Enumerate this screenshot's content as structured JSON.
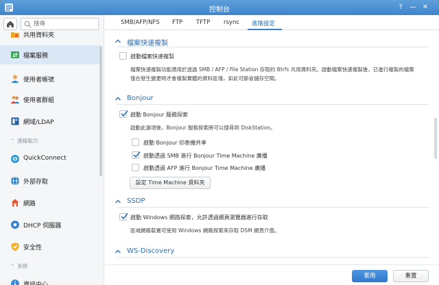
{
  "window": {
    "title": "控制台"
  },
  "sidebar": {
    "search_placeholder": "搜尋",
    "items": [
      {
        "label": "共用資料夾",
        "icon": "folder-share-icon"
      },
      {
        "label": "檔案服務",
        "icon": "file-services-icon",
        "active": true
      },
      {
        "label": "使用者帳號",
        "icon": "user-icon"
      },
      {
        "label": "使用者群組",
        "icon": "user-group-icon"
      },
      {
        "label": "網域/LDAP",
        "icon": "domain-ldap-icon"
      },
      {
        "label": "QuickConnect",
        "icon": "quickconnect-icon"
      },
      {
        "label": "外部存取",
        "icon": "external-access-icon"
      },
      {
        "label": "網路",
        "icon": "network-icon"
      },
      {
        "label": "DHCP 伺服器",
        "icon": "dhcp-server-icon"
      },
      {
        "label": "安全性",
        "icon": "security-icon"
      },
      {
        "label": "資訊中心",
        "icon": "info-center-icon"
      }
    ],
    "sections": [
      "連線能力",
      "系統"
    ]
  },
  "tabs": [
    "SMB/AFP/NFS",
    "FTP",
    "TFTP",
    "rsync",
    "進階設定"
  ],
  "active_tab": "進階設定",
  "file_copy": {
    "heading": "檔案快速複製",
    "checkbox_label": "啟動檔案快速複製",
    "checked": false,
    "description_line1": "檔案快速複製功能適用於透過 SMB / AFP / File Station 存取的 Btrfs 共用資料夾。啟動檔案快速複製後，已進行複製的檔案",
    "description_line2": "僅在發生變更時才會複製實體的資料區塊，如此可節省儲存空間。"
  },
  "bonjour": {
    "heading": "Bonjour",
    "main_label": "啟動 Bonjour 服務探索",
    "main_checked": true,
    "description": "啟動此選項後，Bonjour 服務探索將可以搜尋到 DiskStation。",
    "options": [
      {
        "label": "啟動 Bonjour 印表機共享",
        "checked": false
      },
      {
        "label": "啟動透過 SMB 進行 Bonjour Time Machine 廣播",
        "checked": true
      },
      {
        "label": "啟動透過 AFP 進行 Bonjour Time Machine 廣播",
        "checked": false
      }
    ],
    "button_label": "設定 Time Machine 資料夾"
  },
  "ssdp": {
    "heading": "SSDP",
    "label": "啟動 Windows 網路探索，允許透過網頁瀏覽器進行存取",
    "checked": true,
    "description": "區域網路裝置可使用 Windows 網路探索來存取 DSM 網頁介面。"
  },
  "wsd": {
    "heading": "WS-Discovery"
  },
  "footer": {
    "apply_label": "套用",
    "reset_label": "重置"
  },
  "colors": {
    "titlebar": "#4a8fd6",
    "accent": "#2d6fb5",
    "apply": "#3a7fd0",
    "active_nav": "#dbe8f5"
  }
}
